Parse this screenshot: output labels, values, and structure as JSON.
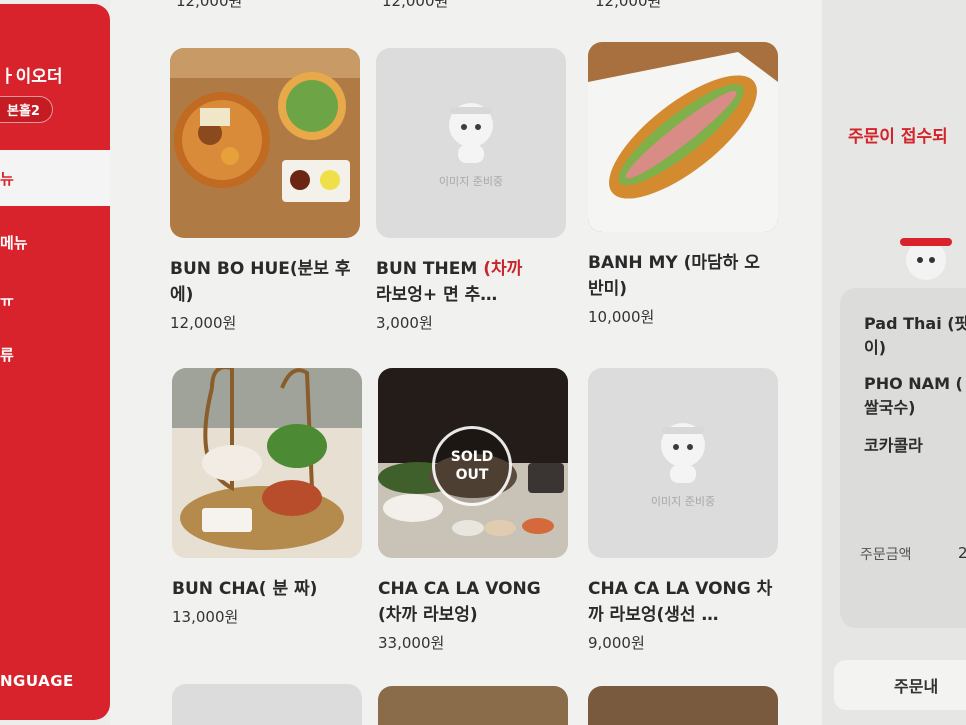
{
  "sidebar": {
    "brand": "ㅏ이오더",
    "table": "본홀2",
    "categories": [
      "뉴",
      "메뉴",
      "ㅠ",
      "류"
    ],
    "language": "NGUAGE"
  },
  "top_prices": [
    "12,000원",
    "12,000원",
    "12,000원"
  ],
  "items": [
    {
      "name": "BUN BO HUE(분보 후에)",
      "name_accent": "",
      "name_rest": "",
      "price": "12,000원",
      "image": "photo"
    },
    {
      "name": "BUN THEM ",
      "name_accent": "(차까",
      "name_rest": "라보엉+ 면 추…",
      "price": "3,000원",
      "image": "placeholder",
      "placeholder_text": "이미지 준비중"
    },
    {
      "name": "BANH MY (마담하 오 반미)",
      "name_accent": "",
      "name_rest": "",
      "price": "10,000원",
      "image": "photo"
    },
    {
      "name": "BUN CHA( 분 짜)",
      "name_accent": "",
      "name_rest": "",
      "price": "13,000원",
      "image": "photo"
    },
    {
      "name": "CHA CA LA VONG (차까 라보엉)",
      "name_accent": "",
      "name_rest": "",
      "price": "33,000원",
      "image": "photo",
      "soldout": [
        "SOLD",
        "OUT"
      ]
    },
    {
      "name": "CHA CA LA VONG 차까 라보엉(생선 …",
      "name_accent": "",
      "name_rest": "",
      "price": "9,000원",
      "image": "placeholder",
      "placeholder_text": "이미지 준비중"
    }
  ],
  "order_panel": {
    "message": "주문이 접수되",
    "items": [
      "Pad Thai (팟",
      "이)",
      "PHO NAM (",
      "쌀국수)",
      "코카콜라"
    ],
    "total_label": "주문금액",
    "total_value": "2",
    "button": "주문내"
  },
  "colors": {
    "brand_red": "#d9232c",
    "accent_red": "#c8262d"
  }
}
